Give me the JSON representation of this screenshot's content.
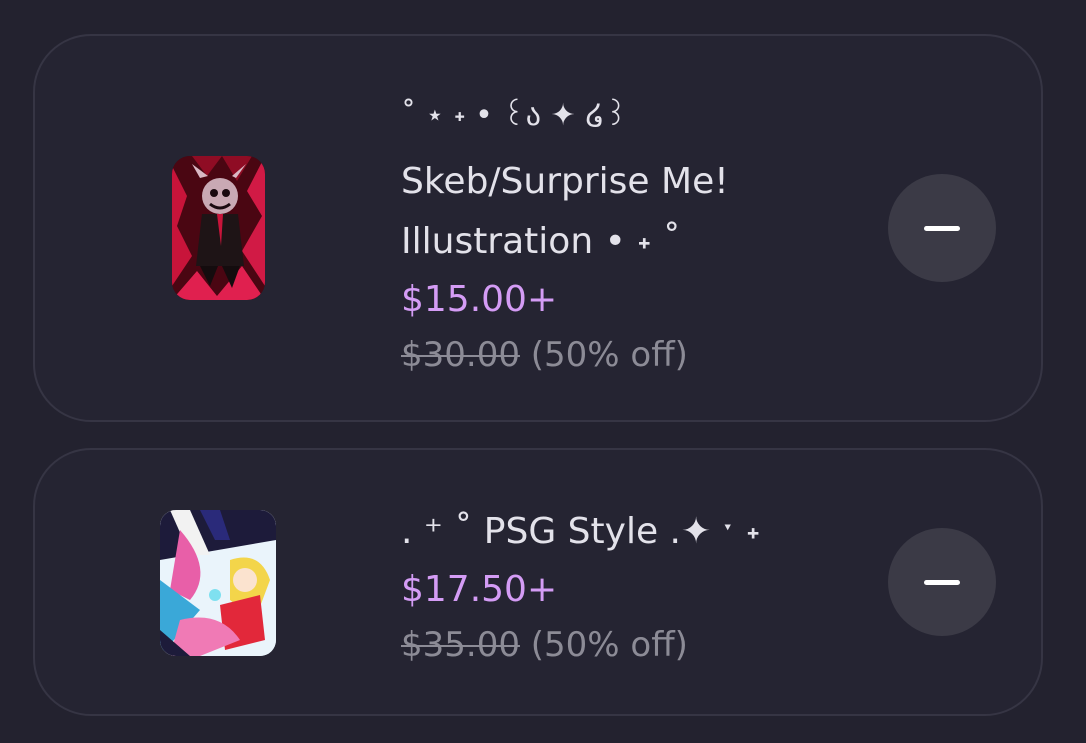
{
  "cart": {
    "items": [
      {
        "title_line1": "˚ ⋆ ˖  • ꒰ა ✦ ໒꒱",
        "title_rest": "Skeb/Surprise Me!\nIllustration • ˖ ˚",
        "price": "$15.00+",
        "original_price": "$30.00",
        "discount": "(50% off)"
      },
      {
        "title_line1": ". ⁺ ˚ PSG Style .✦ ˑ ˖",
        "title_rest": "",
        "price": "$17.50+",
        "original_price": "$35.00",
        "discount": "(50% off)"
      }
    ],
    "colors": {
      "background": "#23222f",
      "card_border": "#363544",
      "price": "#d49cf5",
      "muted": "#8c8b96",
      "remove_button": "#3b3a46"
    },
    "icons": [
      "minus-icon",
      "minus-icon"
    ]
  }
}
